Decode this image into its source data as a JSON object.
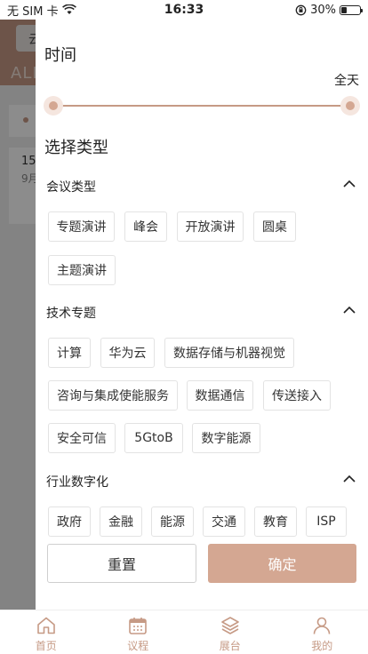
{
  "status_bar": {
    "carrier": "无 SIM 卡",
    "time": "16:33",
    "battery": "30%",
    "battery_level": 0.3
  },
  "background": {
    "pill_text": "云",
    "header_text": "ALL",
    "date_day": "15",
    "date_month": "9月"
  },
  "filter": {
    "time_title": "时间",
    "time_value": "全天",
    "type_title": "选择类型",
    "groups": [
      {
        "title": "会议类型",
        "chips": [
          "专题演讲",
          "峰会",
          "开放演讲",
          "圆桌",
          "主题演讲"
        ]
      },
      {
        "title": "技术专题",
        "chips": [
          "计算",
          "华为云",
          "数据存储与机器视觉",
          "咨询与集成使能服务",
          "数据通信",
          "传送接入",
          "安全可信",
          "5GtoB",
          "数字能源"
        ]
      },
      {
        "title": "行业数字化",
        "chips": [
          "政府",
          "金融",
          "能源",
          "交通",
          "教育",
          "ISP"
        ]
      }
    ],
    "reset_label": "重置",
    "confirm_label": "确定"
  },
  "tabbar": {
    "items": [
      {
        "label": "首页",
        "icon": "home-icon"
      },
      {
        "label": "议程",
        "icon": "calendar-icon"
      },
      {
        "label": "展台",
        "icon": "layers-icon"
      },
      {
        "label": "我的",
        "icon": "user-icon"
      }
    ],
    "accent": "#c69a85"
  },
  "colors": {
    "accent": "#c69a85",
    "confirm_bg": "#d4a792"
  }
}
